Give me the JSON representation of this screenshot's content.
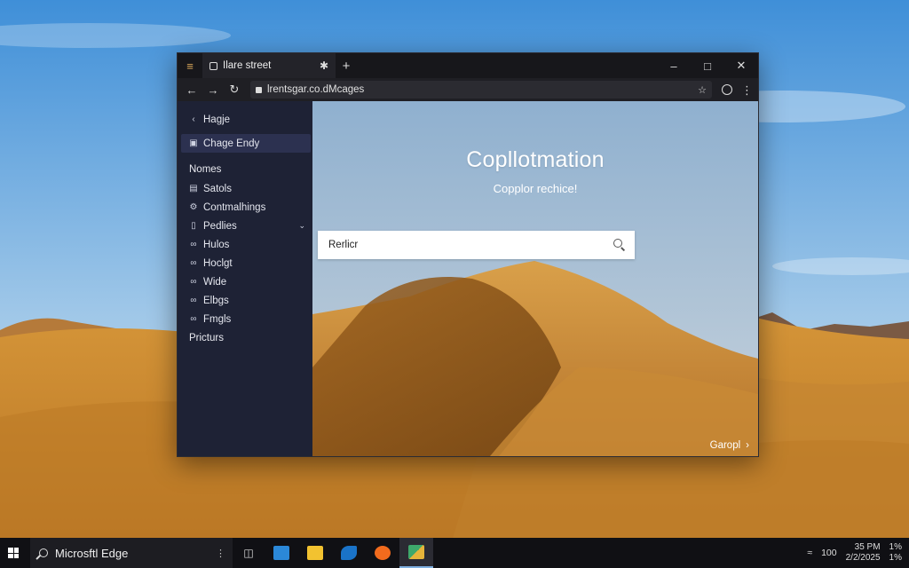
{
  "browser": {
    "tab_title": "Ilare street",
    "url": "lrentsgar.co.dMcages",
    "new_tab_symbol": "+"
  },
  "sidebar": {
    "back_label": "Hagje",
    "active_item": "Chage Endy",
    "sections": [
      {
        "header": "Nomes",
        "items": [
          {
            "label": "Satols",
            "icon": "list-icon"
          },
          {
            "label": "Contmalhings",
            "icon": "settings-icon"
          },
          {
            "label": "Pedlies",
            "icon": "document-icon",
            "expandable": true
          },
          {
            "label": "Hulos",
            "icon": "link-icon"
          },
          {
            "label": "Hoclgt",
            "icon": "link-icon"
          },
          {
            "label": "Wide",
            "icon": "link-icon"
          },
          {
            "label": "Elbgs",
            "icon": "link-icon"
          },
          {
            "label": "Fmgls",
            "icon": "link-icon"
          }
        ]
      },
      {
        "header": "Pricturs",
        "items": []
      }
    ]
  },
  "main": {
    "headline": "Copllotmation",
    "subline": "Copplor rechice!",
    "search_placeholder": "Rerlicr",
    "corner_link": "Garopl"
  },
  "taskbar": {
    "search_text": "Microsftl Edge",
    "clock_time": "35 PM",
    "clock_date": "2/2/2025",
    "tray_number": "100",
    "tray_extra_top": "1%",
    "tray_extra_bottom": "1%"
  },
  "colors": {
    "sidebar_bg": "#1e2235",
    "titlebar_bg": "#17171b",
    "taskbar_bg": "#101014",
    "sand": "#c98a2e",
    "sky": "#5f9fd6"
  }
}
